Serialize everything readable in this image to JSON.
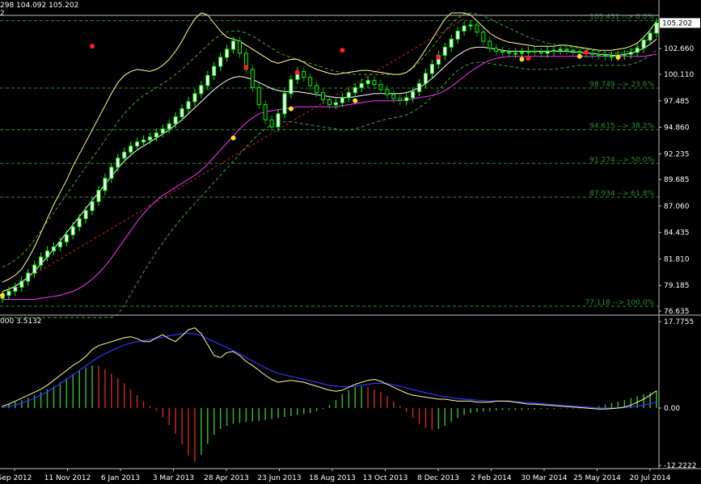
{
  "header": {
    "price_line": "298 104.092 105.202",
    "price_line2": "2",
    "sub_line": "000 3.5132"
  },
  "colors": {
    "background": "#000000",
    "axis": "#c0c0c0",
    "bull": "#00ff00",
    "bull_body": "#ffffff",
    "bear": "#00aa00",
    "bollinger_outer": "#ffff99",
    "bollinger_mid": "#ffffff",
    "envelope": "#3aa83a",
    "ma_magenta": "#ff33ff",
    "trend_red": "#cc2222",
    "fib": "#2e8b2e",
    "macd_line": "#ffff99",
    "signal_line": "#3333ff",
    "hist_up": "#2db82d",
    "hist_down": "#cc2222",
    "fractal_up": "#ff2222",
    "fractal_down": "#ffdd22",
    "current_price_bg": "#ffffff"
  },
  "chart_data": [
    {
      "type": "line",
      "panel": "price",
      "ylim": [
        76.635,
        106.2
      ],
      "y_ticks": [
        "105.202",
        "102.660",
        "100.110",
        "97.485",
        "94.860",
        "92.235",
        "89.685",
        "87.060",
        "84.435",
        "81.810",
        "79.185",
        "76.635"
      ],
      "y_tick_values": [
        105.202,
        102.66,
        100.11,
        97.485,
        94.86,
        92.235,
        89.685,
        87.06,
        84.435,
        81.81,
        79.185,
        76.635
      ],
      "current_price": "105.202",
      "x_ticks": [
        "Sep 2012",
        "11 Nov 2012",
        "6 Jan 2013",
        "3 Mar 2013",
        "28 Apr 2013",
        "23 Jun 2013",
        "18 Aug 2013",
        "13 Oct 2013",
        "8 Dec 2013",
        "2 Feb 2014",
        "30 Mar 2014",
        "25 May 2014",
        "20 Jul 2014"
      ],
      "fib_levels": [
        {
          "label": "105.431 --> 0.0%",
          "value": 105.431
        },
        {
          "label": "98.749 --> 23.6%",
          "value": 98.749
        },
        {
          "label": "94.615 --> 38.2%",
          "value": 94.615
        },
        {
          "label": "91.274 --> 50.0%",
          "value": 91.274
        },
        {
          "label": "87.934 --> 61.8%",
          "value": 87.934
        },
        {
          "label": "77.118 --> 100.0%",
          "value": 77.118
        }
      ],
      "close": [
        78.2,
        78.6,
        79.0,
        79.6,
        80.4,
        81.2,
        82.0,
        82.6,
        83.0,
        83.5,
        84.2,
        85.0,
        85.8,
        86.6,
        87.5,
        88.6,
        89.8,
        90.9,
        91.8,
        92.4,
        93.0,
        93.4,
        93.6,
        93.9,
        94.3,
        94.7,
        95.2,
        95.9,
        96.7,
        97.4,
        98.2,
        99.0,
        100.0,
        100.9,
        101.8,
        102.6,
        103.4,
        102.2,
        100.6,
        98.8,
        97.1,
        95.6,
        94.9,
        96.2,
        98.2,
        99.6,
        100.4,
        99.8,
        99.0,
        98.3,
        97.6,
        97.1,
        97.3,
        97.8,
        98.3,
        98.8,
        99.2,
        99.5,
        99.1,
        98.6,
        98.1,
        97.7,
        97.5,
        97.8,
        98.4,
        99.2,
        100.2,
        101.1,
        102.0,
        102.8,
        103.6,
        104.4,
        104.9,
        105.0,
        104.3,
        103.4,
        102.7,
        102.4,
        102.3,
        102.2,
        102.2,
        102.3,
        102.4,
        102.3,
        102.2,
        102.4,
        102.5,
        102.6,
        102.5,
        102.4,
        102.3,
        102.2,
        102.1,
        102.0,
        101.9,
        101.9,
        102.0,
        102.1,
        102.3,
        102.7,
        103.5,
        104.2,
        105.2
      ],
      "open": [
        77.9,
        78.2,
        78.6,
        79.0,
        79.6,
        80.4,
        81.2,
        82.0,
        82.6,
        83.0,
        83.5,
        84.2,
        85.0,
        85.8,
        86.6,
        87.5,
        88.6,
        89.8,
        90.9,
        91.8,
        92.4,
        93.0,
        93.4,
        93.6,
        93.9,
        94.3,
        94.7,
        95.2,
        95.9,
        96.7,
        97.4,
        98.2,
        99.0,
        100.0,
        100.9,
        101.8,
        102.6,
        103.4,
        102.2,
        100.6,
        98.8,
        97.1,
        95.6,
        94.9,
        96.2,
        98.2,
        99.6,
        100.4,
        99.8,
        99.0,
        98.3,
        97.6,
        97.1,
        97.3,
        97.8,
        98.3,
        98.8,
        99.2,
        99.5,
        99.1,
        98.6,
        98.1,
        97.7,
        97.5,
        97.8,
        98.4,
        99.2,
        100.2,
        101.1,
        102.0,
        102.8,
        103.6,
        104.4,
        104.9,
        105.0,
        104.3,
        103.4,
        102.7,
        102.4,
        102.3,
        102.2,
        102.2,
        102.3,
        102.4,
        102.3,
        102.2,
        102.4,
        102.5,
        102.6,
        102.5,
        102.4,
        102.3,
        102.2,
        102.1,
        102.0,
        101.9,
        101.9,
        102.0,
        102.1,
        102.3,
        102.7,
        103.5,
        104.2
      ],
      "bb_upper": [
        79.5,
        79.8,
        80.2,
        80.8,
        81.8,
        83.0,
        84.4,
        85.8,
        87.2,
        88.4,
        89.6,
        91.0,
        92.2,
        93.4,
        94.6,
        95.8,
        97.0,
        98.2,
        99.3,
        100.0,
        100.4,
        100.6,
        100.5,
        100.4,
        100.6,
        101.0,
        101.6,
        102.4,
        103.4,
        104.6,
        105.6,
        106.2,
        106.0,
        105.2,
        104.4,
        103.8,
        103.6,
        103.4,
        103.0,
        102.6,
        102.2,
        101.8,
        101.4,
        101.2,
        101.4,
        101.6,
        101.6,
        101.3,
        100.9,
        100.6,
        100.4,
        100.2,
        100.1,
        100.2,
        100.3,
        100.4,
        100.5,
        100.5,
        100.4,
        100.3,
        100.2,
        100.1,
        100.1,
        100.3,
        100.8,
        101.6,
        102.6,
        103.6,
        104.6,
        105.6,
        106.2,
        106.2,
        106.2,
        106.0,
        105.4,
        104.8,
        104.2,
        103.8,
        103.5,
        103.3,
        103.2,
        103.1,
        103.0,
        102.9,
        102.9,
        102.9,
        102.9,
        103.0,
        103.0,
        102.9,
        102.8,
        102.7,
        102.6,
        102.5,
        102.5,
        102.5,
        102.6,
        102.7,
        102.9,
        103.2,
        103.8,
        104.5,
        105.4
      ],
      "bb_mid": [
        78.6,
        78.8,
        79.1,
        79.5,
        80.0,
        80.6,
        81.3,
        82.0,
        82.8,
        83.6,
        84.4,
        85.2,
        86.0,
        86.8,
        87.6,
        88.4,
        89.2,
        90.0,
        90.8,
        91.5,
        92.1,
        92.6,
        93.0,
        93.4,
        93.8,
        94.2,
        94.6,
        95.1,
        95.6,
        96.2,
        96.8,
        97.4,
        98.0,
        98.6,
        99.1,
        99.5,
        99.8,
        99.9,
        99.8,
        99.6,
        99.3,
        99.0,
        98.7,
        98.5,
        98.4,
        98.4,
        98.4,
        98.3,
        98.2,
        98.1,
        98.0,
        97.9,
        97.8,
        97.8,
        97.8,
        97.9,
        98.0,
        98.1,
        98.2,
        98.2,
        98.2,
        98.2,
        98.2,
        98.3,
        98.5,
        98.8,
        99.2,
        99.7,
        100.3,
        100.9,
        101.5,
        102.0,
        102.4,
        102.7,
        102.8,
        102.8,
        102.7,
        102.6,
        102.5,
        102.4,
        102.4,
        102.4,
        102.4,
        102.4,
        102.4,
        102.4,
        102.4,
        102.4,
        102.4,
        102.3,
        102.3,
        102.2,
        102.2,
        102.1,
        102.1,
        102.0,
        102.0,
        102.1,
        102.2,
        102.4,
        102.7,
        103.1,
        103.6
      ],
      "ma_magenta": [
        77.8,
        77.8,
        77.8,
        77.8,
        77.8,
        77.8,
        77.9,
        78.0,
        78.1,
        78.2,
        78.4,
        78.6,
        78.9,
        79.3,
        79.8,
        80.4,
        81.1,
        81.9,
        82.8,
        83.7,
        84.6,
        85.5,
        86.3,
        87.0,
        87.6,
        88.1,
        88.5,
        88.9,
        89.3,
        89.7,
        90.1,
        90.6,
        91.2,
        91.9,
        92.6,
        93.3,
        94.0,
        94.7,
        95.3,
        95.8,
        96.2,
        96.4,
        96.5,
        96.6,
        96.7,
        96.8,
        96.9,
        96.9,
        96.9,
        96.9,
        96.9,
        96.9,
        96.9,
        97.0,
        97.1,
        97.2,
        97.3,
        97.4,
        97.5,
        97.5,
        97.5,
        97.5,
        97.5,
        97.6,
        97.7,
        97.8,
        97.9,
        98.0,
        98.2,
        98.5,
        98.9,
        99.4,
        99.9,
        100.4,
        100.8,
        101.2,
        101.5,
        101.7,
        101.8,
        101.9,
        101.9,
        101.9,
        101.9,
        101.9,
        101.9,
        101.9,
        101.9,
        101.9,
        101.9,
        101.9,
        101.9,
        101.9,
        101.9,
        101.9,
        101.9,
        101.9,
        101.9,
        101.9,
        101.9,
        101.9,
        101.9,
        102.0,
        102.1
      ],
      "env_upper": [
        81.0,
        81.3,
        81.7,
        82.2,
        82.9,
        83.7,
        84.6,
        85.5,
        86.4,
        87.3,
        88.2,
        89.1,
        90.0,
        90.9,
        91.8,
        92.7,
        93.6,
        94.5,
        95.4,
        96.2,
        96.9,
        97.5,
        98.0,
        98.4,
        98.8,
        99.2,
        99.6,
        100.1,
        100.6,
        101.2,
        101.8,
        102.4,
        103.0,
        103.6,
        104.0,
        104.3,
        104.4,
        104.4,
        104.2,
        103.9,
        103.5,
        103.1,
        102.7,
        102.3,
        102.0,
        101.8,
        101.6,
        101.4,
        101.2,
        101.0,
        100.8,
        100.6,
        100.4,
        100.3,
        100.2,
        100.1,
        100.1,
        100.1,
        100.1,
        100.1,
        100.1,
        100.1,
        100.1,
        100.3,
        100.7,
        101.3,
        102.0,
        102.8,
        103.6,
        104.4,
        105.1,
        105.7,
        106.1,
        106.2,
        106.1,
        105.9,
        105.6,
        105.3,
        105.0,
        104.7,
        104.4,
        104.1,
        103.8,
        103.6,
        103.4,
        103.2,
        103.1,
        103.0,
        102.9,
        102.8,
        102.7,
        102.6,
        102.5,
        102.4,
        102.3,
        102.2,
        102.2,
        102.3,
        102.5,
        102.8,
        103.2,
        103.8,
        104.5
      ],
      "env_lower": [
        76.0,
        76.0,
        76.0,
        76.0,
        76.0,
        76.0,
        76.0,
        76.0,
        76.0,
        76.0,
        76.0,
        76.0,
        76.0,
        76.0,
        76.0,
        76.0,
        76.0,
        76.0,
        76.3,
        77.2,
        78.3,
        79.4,
        80.5,
        81.5,
        82.5,
        83.4,
        84.3,
        85.1,
        85.9,
        86.6,
        87.3,
        88.0,
        88.7,
        89.4,
        90.1,
        90.8,
        91.5,
        92.2,
        92.9,
        93.6,
        94.2,
        94.7,
        95.1,
        95.3,
        95.4,
        95.4,
        95.3,
        95.2,
        95.1,
        95.0,
        94.9,
        94.8,
        94.7,
        94.6,
        94.6,
        94.7,
        94.9,
        95.1,
        95.3,
        95.5,
        95.7,
        95.8,
        95.9,
        96.1,
        96.4,
        96.8,
        97.3,
        97.9,
        98.5,
        99.2,
        99.9,
        100.5,
        100.9,
        101.2,
        101.3,
        101.3,
        101.2,
        101.1,
        101.0,
        100.9,
        100.8,
        100.7,
        100.6,
        100.6,
        100.6,
        100.6,
        100.6,
        100.7,
        100.8,
        100.9,
        101.0,
        101.0,
        101.0,
        101.0,
        101.0,
        101.0,
        101.0,
        101.0,
        101.1,
        101.3,
        101.6,
        102.0,
        102.5
      ],
      "fractals_up": [
        [
          14,
          102.9
        ],
        [
          38,
          100.8
        ],
        [
          46,
          100.3
        ],
        [
          53,
          102.5
        ],
        [
          68,
          101.8
        ],
        [
          82,
          101.7
        ],
        [
          91,
          102.3
        ]
      ],
      "fractals_down": [
        [
          0,
          78.2
        ],
        [
          36,
          93.8
        ],
        [
          45,
          96.7
        ],
        [
          55,
          97.5
        ],
        [
          81,
          101.6
        ],
        [
          90,
          101.9
        ],
        [
          96,
          101.8
        ]
      ]
    },
    {
      "type": "bar",
      "panel": "oscillator",
      "ylim": [
        -12.2222,
        17.7755
      ],
      "y_ticks": [
        "17.7755",
        "0.00",
        "-12.2222"
      ],
      "y_tick_values": [
        17.7755,
        0,
        -12.2222
      ],
      "histogram": [
        0.5,
        0.8,
        1.2,
        1.6,
        2.1,
        2.6,
        3.2,
        3.8,
        4.4,
        5.2,
        6.0,
        6.9,
        7.6,
        8.2,
        8.6,
        8.5,
        7.9,
        7.0,
        6.0,
        5.0,
        3.8,
        2.6,
        1.4,
        0.4,
        -0.6,
        -1.9,
        -3.4,
        -5.2,
        -7.4,
        -9.6,
        -10.8,
        -9.4,
        -7.2,
        -5.4,
        -4.2,
        -3.6,
        -3.2,
        -3.0,
        -2.8,
        -2.7,
        -2.6,
        -2.4,
        -2.2,
        -2.0,
        -1.8,
        -1.6,
        -1.4,
        -1.2,
        -1.0,
        -0.6,
        -0.2,
        0.6,
        1.6,
        2.8,
        3.6,
        4.2,
        4.4,
        4.2,
        3.8,
        3.2,
        2.4,
        1.4,
        0.4,
        -0.8,
        -2.0,
        -3.2,
        -4.0,
        -4.4,
        -4.2,
        -3.6,
        -2.8,
        -2.0,
        -1.4,
        -1.0,
        -0.8,
        -0.7,
        -0.6,
        -0.5,
        -0.4,
        -0.4,
        -0.4,
        -0.4,
        -0.3,
        -0.3,
        -0.2,
        -0.2,
        -0.2,
        -0.1,
        -0.1,
        -0.1,
        -0.1,
        0.0,
        0.2,
        0.4,
        0.7,
        1.0,
        1.3,
        1.6,
        2.0,
        2.4,
        2.8,
        3.1,
        3.5
      ],
      "macd": [
        0.4,
        0.8,
        1.4,
        2.0,
        2.6,
        3.2,
        3.8,
        4.6,
        5.6,
        6.6,
        7.6,
        8.6,
        9.4,
        10.4,
        11.8,
        12.6,
        13.0,
        13.4,
        13.8,
        14.2,
        14.4,
        14.0,
        13.4,
        13.4,
        14.2,
        14.8,
        14.0,
        13.4,
        14.6,
        15.8,
        16.2,
        15.0,
        12.8,
        10.6,
        10.2,
        11.2,
        11.4,
        10.6,
        9.4,
        8.6,
        7.6,
        6.6,
        5.8,
        5.2,
        5.4,
        5.6,
        5.4,
        5.2,
        4.8,
        4.4,
        4.0,
        3.6,
        3.4,
        3.6,
        4.2,
        4.8,
        5.2,
        5.6,
        5.8,
        5.4,
        4.8,
        4.2,
        3.6,
        3.0,
        2.6,
        2.4,
        2.2,
        2.0,
        1.8,
        1.8,
        1.6,
        1.4,
        1.4,
        1.4,
        1.2,
        1.2,
        1.2,
        1.4,
        1.4,
        1.4,
        1.2,
        1.0,
        0.8,
        0.8,
        0.7,
        0.6,
        0.5,
        0.4,
        0.3,
        0.2,
        0.1,
        0.0,
        -0.1,
        -0.2,
        -0.2,
        -0.1,
        0.0,
        0.2,
        0.6,
        1.2,
        1.8,
        2.6,
        3.5
      ],
      "signal": [
        0.1,
        0.3,
        0.6,
        1.0,
        1.5,
        2.0,
        2.6,
        3.3,
        4.1,
        4.9,
        5.8,
        6.7,
        7.6,
        8.5,
        9.4,
        10.3,
        11.0,
        11.6,
        12.2,
        12.7,
        13.1,
        13.4,
        13.6,
        13.8,
        14.0,
        14.3,
        14.6,
        14.8,
        15.0,
        15.1,
        15.0,
        14.6,
        14.0,
        13.4,
        12.8,
        12.2,
        11.6,
        10.9,
        10.2,
        9.5,
        8.8,
        8.1,
        7.5,
        7.0,
        6.7,
        6.4,
        6.1,
        5.8,
        5.5,
        5.2,
        4.9,
        4.6,
        4.4,
        4.3,
        4.3,
        4.4,
        4.6,
        4.8,
        5.0,
        5.0,
        4.9,
        4.7,
        4.4,
        4.1,
        3.7,
        3.4,
        3.1,
        2.8,
        2.5,
        2.3,
        2.1,
        1.9,
        1.8,
        1.7,
        1.6,
        1.5,
        1.4,
        1.4,
        1.4,
        1.3,
        1.3,
        1.2,
        1.1,
        1.0,
        0.9,
        0.8,
        0.7,
        0.6,
        0.5,
        0.4,
        0.3,
        0.2,
        0.1,
        0.0,
        0.0,
        0.0,
        0.0,
        0.1,
        0.2,
        0.4,
        0.6,
        0.9,
        1.2
      ]
    }
  ]
}
